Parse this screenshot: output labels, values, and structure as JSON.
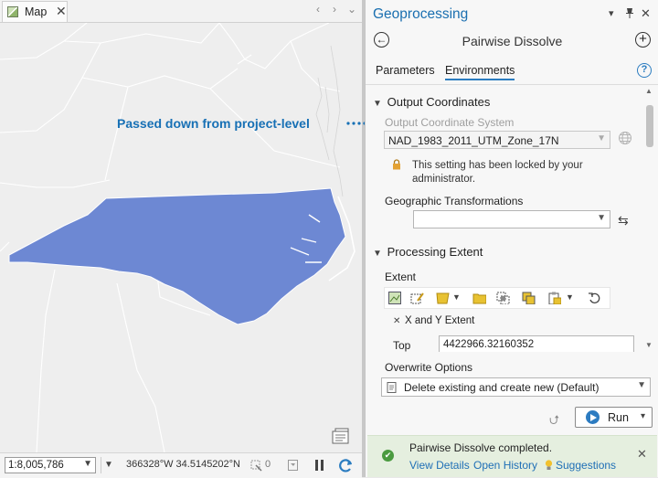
{
  "map": {
    "tab_label": "Map",
    "tab_close": "✕",
    "nav_prev": "‹",
    "nav_next": "›",
    "nav_menu": "⌄",
    "scale": "1:8,005,786",
    "coords": "366328°W 34.5145202°N",
    "selected_count": "0",
    "state_fill": "#6d88d3",
    "background": "#eeeeee"
  },
  "annotation": {
    "text": "Passed down from project-level",
    "color": "#1770b5"
  },
  "geoprocessing": {
    "pane_title": "Geoprocessing",
    "tool_name": "Pairwise Dissolve",
    "tabs": [
      {
        "label": "Parameters",
        "active": false
      },
      {
        "label": "Environments",
        "active": true
      }
    ],
    "sections": {
      "output_coordinates": {
        "title": "Output Coordinates",
        "coord_system_label": "Output Coordinate System",
        "coord_system_value": "NAD_1983_2011_UTM_Zone_17N",
        "locked_message": "This setting has been locked by your administrator.",
        "geo_transform_label": "Geographic Transformations",
        "geo_transform_value": ""
      },
      "processing_extent": {
        "title": "Processing Extent",
        "extent_label": "Extent",
        "xy_label": "X and Y Extent",
        "top_label": "Top",
        "top_value": "4422966.32160352"
      }
    },
    "overwrite": {
      "label": "Overwrite Options",
      "value": "Delete existing and create new (Default)"
    },
    "run_label": "Run",
    "status": {
      "message": "Pairwise Dissolve completed.",
      "links": [
        "View Details",
        "Open History",
        "Suggestions"
      ],
      "color": "#e5efdf"
    },
    "accent": "#1a6fb0"
  }
}
